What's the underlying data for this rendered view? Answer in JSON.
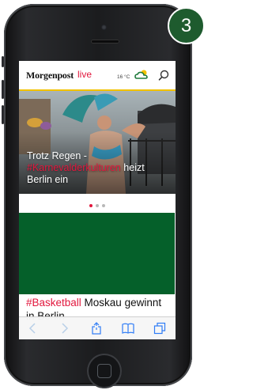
{
  "badge": {
    "number": "3"
  },
  "header": {
    "logo_main": "Morgenpost",
    "logo_live": "live",
    "temperature": "16 °C",
    "weather_icon": "cloud-sun-icon",
    "search_icon": "search-icon"
  },
  "hero": {
    "text_before": "Trotz Regen -",
    "tag": "#Karnevalderkulturen",
    "text_after": " heizt Berlin ein"
  },
  "carousel": {
    "count": 3,
    "active": 1
  },
  "article": {
    "tag": "#Basketball",
    "text": " Moskau gewinnt in Berlin"
  },
  "toolbar": {
    "icons": [
      "back-icon",
      "forward-icon",
      "share-icon",
      "bookmarks-icon",
      "tabs-icon"
    ]
  },
  "colors": {
    "accent": "#e2173d",
    "header_rule": "#f2c200",
    "ad_green": "#05602a",
    "badge_green": "#1e5b2e"
  }
}
